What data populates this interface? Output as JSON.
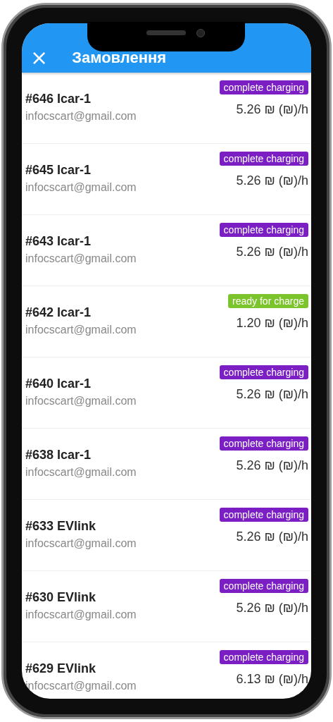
{
  "header": {
    "close_icon": "×",
    "title": "Замовлення"
  },
  "orders": [
    {
      "title": "#646 Icar-1",
      "email": "infocscart@gmail.com",
      "status": "complete charging",
      "color": "#7b1fc4",
      "price": "5.26 ₪ (₪)/h"
    },
    {
      "title": "#645 Icar-1",
      "email": "infocscart@gmail.com",
      "status": "complete charging",
      "color": "#7b1fc4",
      "price": "5.26 ₪ (₪)/h"
    },
    {
      "title": "#643 Icar-1",
      "email": "infocscart@gmail.com",
      "status": "complete charging",
      "color": "#7b1fc4",
      "price": "5.26 ₪ (₪)/h"
    },
    {
      "title": "#642 Icar-1",
      "email": "infocscart@gmail.com",
      "status": "ready for charge",
      "color": "#7cc42c",
      "price": "1.20 ₪ (₪)/h"
    },
    {
      "title": "#640 Icar-1",
      "email": "infocscart@gmail.com",
      "status": "complete charging",
      "color": "#7b1fc4",
      "price": "5.26 ₪ (₪)/h"
    },
    {
      "title": "#638 Icar-1",
      "email": "infocscart@gmail.com",
      "status": "complete charging",
      "color": "#7b1fc4",
      "price": "5.26 ₪ (₪)/h"
    },
    {
      "title": "#633 EVlink",
      "email": "infocscart@gmail.com",
      "status": "complete charging",
      "color": "#7b1fc4",
      "price": "5.26 ₪ (₪)/h"
    },
    {
      "title": "#630 EVlink",
      "email": "infocscart@gmail.com",
      "status": "complete charging",
      "color": "#7b1fc4",
      "price": "5.26 ₪ (₪)/h"
    },
    {
      "title": "#629 EVlink",
      "email": "infocscart@gmail.com",
      "status": "complete charging",
      "color": "#7b1fc4",
      "price": "6.13 ₪ (₪)/h"
    }
  ]
}
